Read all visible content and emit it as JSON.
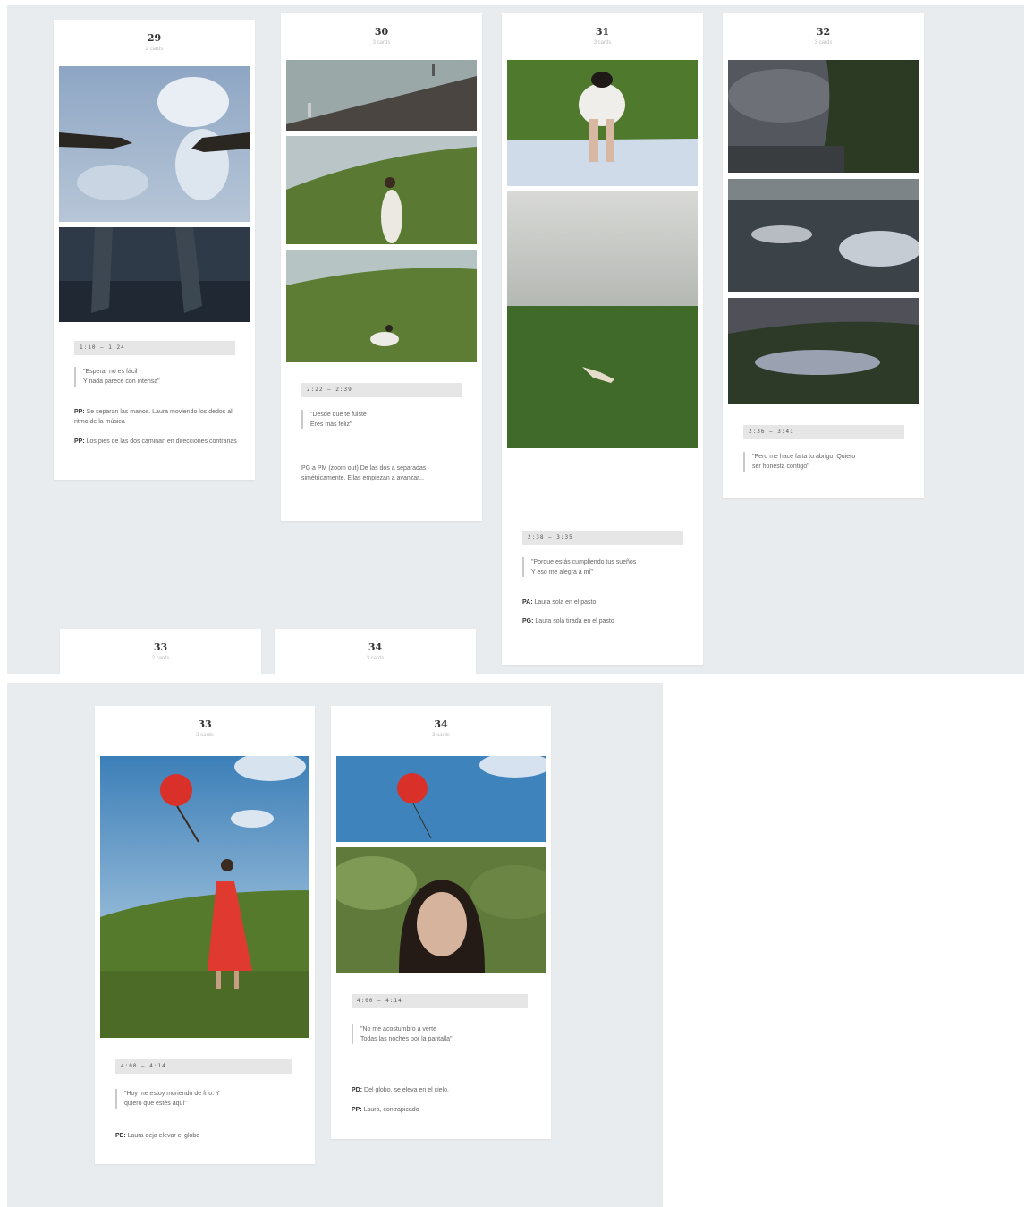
{
  "boards": [
    {
      "cards": [
        {
          "number": "29",
          "subtitle": "2 cards",
          "timecode": "1:10 – 1:24",
          "quote": [
            "\"Esperar no es fácil",
            "Y nada parece con intensa\""
          ],
          "notes": [
            {
              "tag": "PP:",
              "text": "Se separan las manos. Laura moviendo los dedos al ritmo de la música"
            },
            {
              "tag": "PP:",
              "text": "Los pies de las dos caminan en direcciones contrarias"
            }
          ]
        },
        {
          "number": "30",
          "subtitle": "3 cards",
          "timecode": "2:22 – 2:39",
          "quote": [
            "\"Desde que te fuiste",
            "Eres más feliz\""
          ],
          "notes": [
            {
              "tag": "",
              "text": "PG a PM (zoom out) De las dos a separadas simétricamente. Ellas empiezan a avanzar..."
            }
          ]
        },
        {
          "number": "31",
          "subtitle": "3 cards",
          "timecode": "2:38 – 3:35",
          "quote": [
            "\"Porque estás cumpliendo tus sueños",
            "Y eso me alegra a mí\""
          ],
          "notes": [
            {
              "tag": "PA:",
              "text": "Laura sola en el pasto"
            },
            {
              "tag": "PG:",
              "text": "Laura sola tirada en el pasto"
            }
          ]
        },
        {
          "number": "32",
          "subtitle": "3 cards",
          "timecode": "2:36 – 3:41",
          "quote": [
            "\"Pero me hace falta tu abrigo. Quiero",
            "ser honesta contigo\""
          ],
          "notes": []
        },
        {
          "number": "33",
          "subtitle": "2 cards"
        },
        {
          "number": "34",
          "subtitle": "3 cards"
        }
      ]
    },
    {
      "cards": [
        {
          "number": "33",
          "subtitle": "2 cards",
          "timecode": "4:00 – 4:14",
          "quote": [
            "\"Hoy me estoy muriendo de frío. Y",
            "quiero que estés aquí\""
          ],
          "notes": [
            {
              "tag": "PE:",
              "text": "Laura deja elevar el globo"
            }
          ]
        },
        {
          "number": "34",
          "subtitle": "3 cards",
          "timecode": "4:00 – 4:14",
          "quote": [
            "\"No me acostumbro a verte",
            "Todas las noches por la pantalla\""
          ],
          "notes": [
            {
              "tag": "PD:",
              "text": "Del globo, se eleva en el cielo."
            },
            {
              "tag": "PP:",
              "text": "Laura, contrapicado"
            }
          ]
        }
      ]
    }
  ],
  "images": [
    "hands-reaching-sky",
    "feet-walking-dark",
    "hilltop-silhouettes",
    "woman-on-hill",
    "woman-sitting-grass",
    "woman-upside-down",
    "field-cloudy-sky",
    "dark-grass-sky",
    "blanket-figure",
    "person-lying-grass",
    "red-balloon-woman",
    "red-balloon-sky",
    "woman-portrait"
  ],
  "colors": {
    "canvas": "#e9ecee",
    "card": "#ffffff",
    "balloon": "#d9302a",
    "dress": "#e03a30"
  }
}
